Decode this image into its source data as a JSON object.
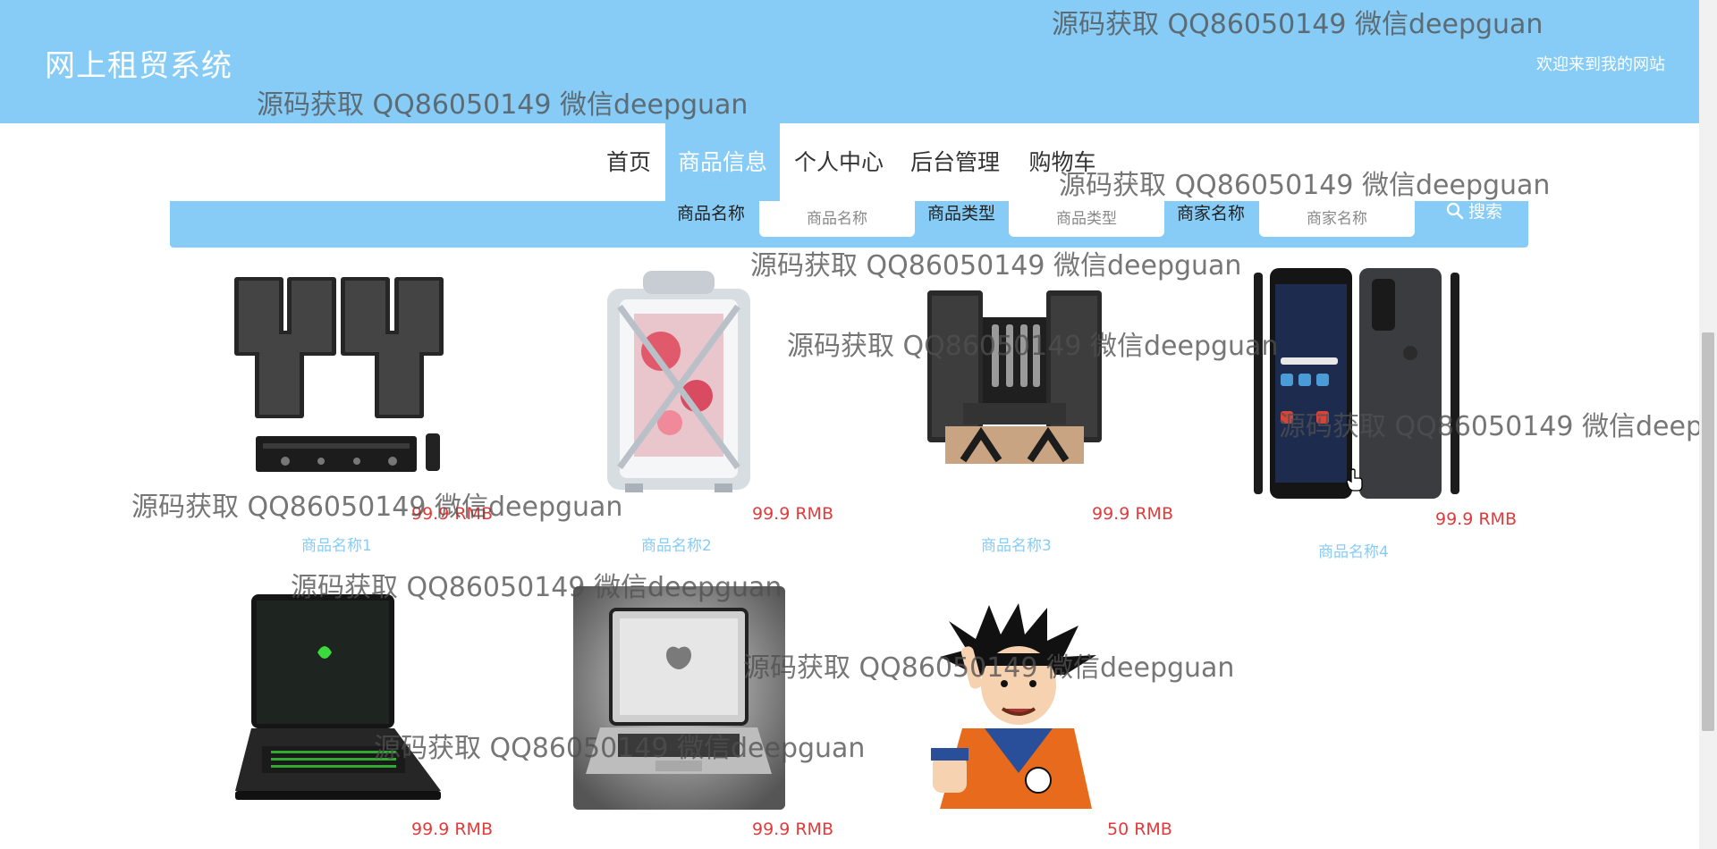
{
  "header": {
    "site_title": "网上租贸系统",
    "welcome": "欢迎来到我的网站"
  },
  "nav": {
    "items": [
      {
        "label": "首页"
      },
      {
        "label": "商品信息",
        "active": true
      },
      {
        "label": "个人中心"
      },
      {
        "label": "后台管理"
      },
      {
        "label": "购物车"
      }
    ]
  },
  "search": {
    "fields": [
      {
        "label": "商品名称",
        "placeholder": "商品名称"
      },
      {
        "label": "商品类型",
        "placeholder": "商品类型"
      },
      {
        "label": "商家名称",
        "placeholder": "商家名称"
      }
    ],
    "button_label": "搜索",
    "button_icon": "search-icon"
  },
  "products": [
    {
      "name": "商品名称1",
      "price": "99.9 RMB",
      "image": "speaker-system"
    },
    {
      "name": "商品名称2",
      "price": "99.9 RMB",
      "image": "gaming-pc-case"
    },
    {
      "name": "商品名称3",
      "price": "99.9 RMB",
      "image": "karaoke-speakers"
    },
    {
      "name": "商品名称4",
      "price": "99.9 RMB",
      "image": "smartphone"
    },
    {
      "name": "",
      "price": "99.9 RMB",
      "image": "gaming-laptop"
    },
    {
      "name": "",
      "price": "99.9 RMB",
      "image": "laptop"
    },
    {
      "name": "",
      "price": "50 RMB",
      "image": "anime-figure"
    }
  ],
  "watermark": {
    "text": "源码获取 QQ86050149 微信deepguan"
  },
  "colors": {
    "primary": "#87ccf6",
    "price": "#e23b3b"
  }
}
